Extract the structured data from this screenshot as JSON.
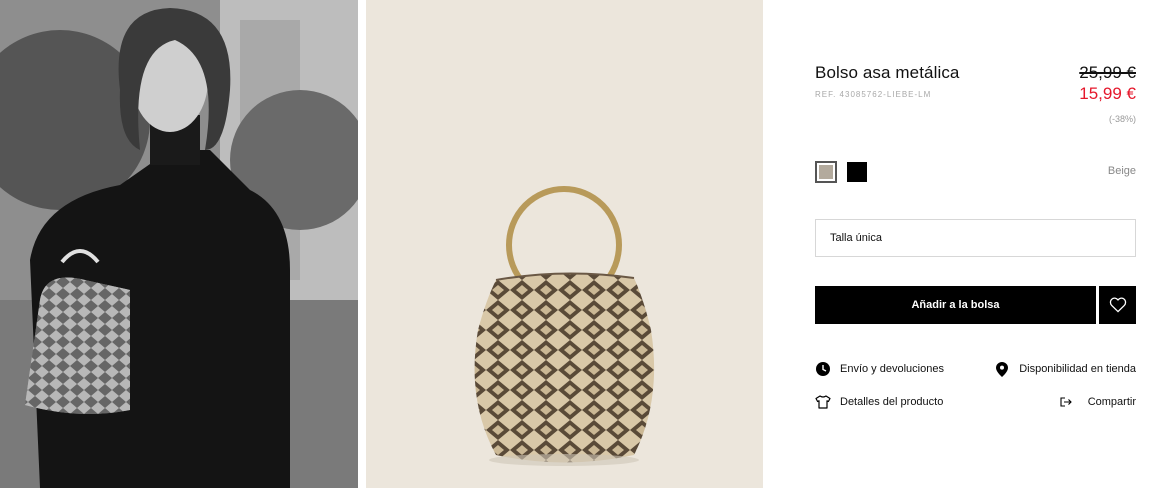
{
  "product": {
    "title": "Bolso asa metálica",
    "ref": "REF. 43085762-LIEBE-LM",
    "price_old": "25,99 €",
    "price_new": "15,99 €",
    "discount": "(-38%)"
  },
  "colors": {
    "selected_name": "Beige",
    "swatches": [
      {
        "name": "Beige",
        "hex": "#b3aa9d"
      },
      {
        "name": "Negro",
        "hex": "#000000"
      }
    ]
  },
  "size": {
    "value": "Talla única"
  },
  "actions": {
    "add_to_bag": "Añadir a la bolsa"
  },
  "links": {
    "shipping": "Envío y devoluciones",
    "store_availability": "Disponibilidad en tienda",
    "details": "Detalles del producto",
    "share": "Compartir"
  },
  "theme": {
    "sale_color": "#e5172b",
    "product_bg": "#ece6dc"
  }
}
